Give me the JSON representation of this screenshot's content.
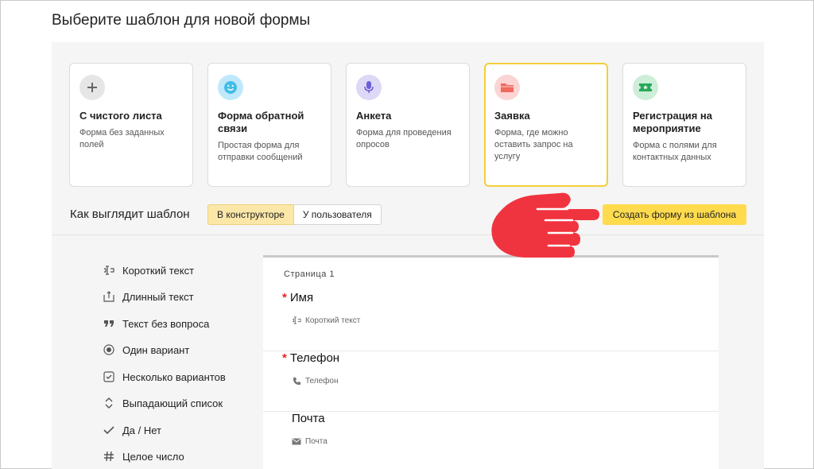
{
  "page_title": "Выберите шаблон для новой формы",
  "templates": [
    {
      "title": "С чистого листа",
      "desc": "Форма без заданных полей",
      "icon": "plus-icon",
      "color": "#e6e6e6"
    },
    {
      "title": "Форма обратной связи",
      "desc": "Простая форма для отправки сообщений",
      "icon": "smile-icon",
      "color": "#bfe9fb"
    },
    {
      "title": "Анкета",
      "desc": "Форма для проведения опросов",
      "icon": "microphone-icon",
      "color": "#dcd8f6"
    },
    {
      "title": "Заявка",
      "desc": "Форма, где можно оставить запрос на услугу",
      "icon": "folder-icon",
      "color": "#fbd4d4"
    },
    {
      "title": "Регистрация на мероприятие",
      "desc": "Форма с полями для контактных данных",
      "icon": "ticket-icon",
      "color": "#cdeed8"
    }
  ],
  "selected_template": "Заявка",
  "preview": {
    "label": "Как выглядит шаблон",
    "tabs": [
      "В конструкторе",
      "У пользователя"
    ],
    "active_tab": "В конструкторе",
    "create_button": "Создать форму из шаблона"
  },
  "field_types": [
    {
      "label": "Короткий текст",
      "icon": "short-text-icon"
    },
    {
      "label": "Длинный текст",
      "icon": "long-text-icon"
    },
    {
      "label": "Текст без вопроса",
      "icon": "quote-icon"
    },
    {
      "label": "Один вариант",
      "icon": "radio-icon"
    },
    {
      "label": "Несколько вариантов",
      "icon": "checkbox-icon"
    },
    {
      "label": "Выпадающий список",
      "icon": "dropdown-icon"
    },
    {
      "label": "Да / Нет",
      "icon": "check-icon"
    },
    {
      "label": "Целое число",
      "icon": "hash-icon"
    }
  ],
  "form": {
    "page_label": "Страница 1",
    "questions": [
      {
        "title": "Имя",
        "required": "*",
        "type": "Короткий текст",
        "icon": "short-text-icon"
      },
      {
        "title": "Телефон",
        "required": "*",
        "type": "Телефон",
        "icon": "phone-icon"
      },
      {
        "title": "Почта",
        "required": "",
        "type": "Почта",
        "icon": "mail-icon"
      }
    ]
  },
  "colors": {
    "accent": "#ffdb4d",
    "selected_border": "#f2cf3a",
    "hand": "#f0343f",
    "required": "#ee2222"
  }
}
